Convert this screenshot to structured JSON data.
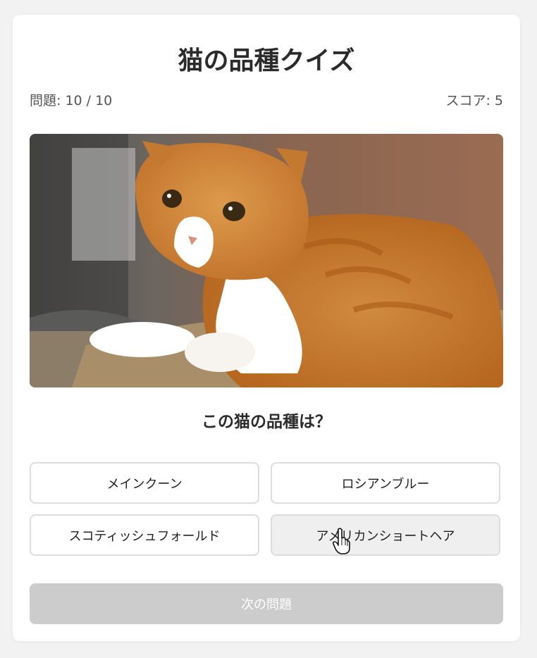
{
  "quiz": {
    "title": "猫の品種クイズ",
    "progress_text": "問題: 10 / 10",
    "score_text": "スコア: 5",
    "question": "この猫の品種は？",
    "options": [
      {
        "label": "メインクーン"
      },
      {
        "label": "ロシアンブルー"
      },
      {
        "label": "スコティッシュフォールド"
      },
      {
        "label": "アメリカンショートヘア",
        "hovered": true
      }
    ],
    "next_button": {
      "label": "次の問題",
      "disabled": true
    }
  },
  "colors": {
    "page_background": "#f2f2f2",
    "card_background": "#ffffff",
    "option_border": "#dddddd",
    "option_hover_background": "#efefef",
    "disabled_button": "#cccccc",
    "heading_text": "#2b2b2b"
  },
  "icons": {
    "cursor": "hand-pointer-icon"
  }
}
